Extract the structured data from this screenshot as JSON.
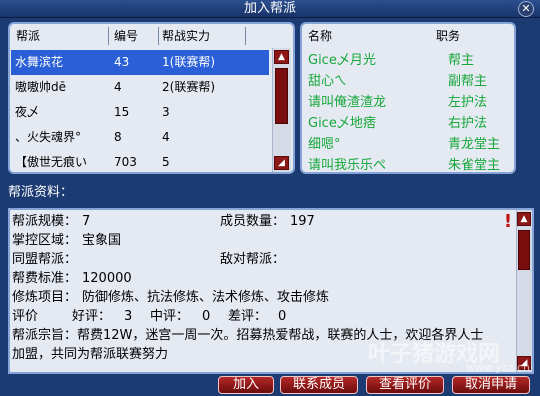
{
  "window": {
    "title": "加入帮派",
    "close_glyph": "✕"
  },
  "guild_list": {
    "headers": [
      "帮派",
      "编号",
      "帮战实力"
    ],
    "rows": [
      {
        "name": "水舞滨花",
        "id": "43",
        "power": "1(联赛帮)",
        "selected": true
      },
      {
        "name": "嗷嗷帅dē",
        "id": "4",
        "power": "2(联赛帮)",
        "selected": false
      },
      {
        "name": "夜乄",
        "id": "15",
        "power": "3",
        "selected": false
      },
      {
        "name": "、火失魂界°",
        "id": "8",
        "power": "4",
        "selected": false
      },
      {
        "name": "【傲世无痕い",
        "id": "703",
        "power": "5",
        "selected": false
      }
    ]
  },
  "member_list": {
    "headers": [
      "名称",
      "职务"
    ],
    "rows": [
      {
        "name": "Gice乄月光",
        "role": "帮主"
      },
      {
        "name": "甜心ㄟ",
        "role": "副帮主"
      },
      {
        "name": "请叫俺渣渣龙",
        "role": "左护法"
      },
      {
        "name": "Gice乄地痞",
        "role": "右护法"
      },
      {
        "name": "细嗯°",
        "role": "青龙堂主"
      },
      {
        "name": "请叫我乐乐ぺ",
        "role": "朱雀堂主"
      }
    ]
  },
  "info": {
    "section_title": "帮派资料：",
    "scale_label": "帮派规模：",
    "scale_value": "7",
    "members_label": "成员数量：",
    "members_value": "197",
    "region_label": "掌控区域：",
    "region_value": "宝象国",
    "ally_label": "同盟帮派：",
    "ally_value": "",
    "enemy_label": "敌对帮派：",
    "enemy_value": "",
    "fee_label": "帮费标准：",
    "fee_value": "120000",
    "cultivation_label": "修炼项目：",
    "cultivation_value": "防御修炼、抗法修炼、法术修炼、攻击修炼",
    "rating_label": "评价",
    "good_label": "好评：",
    "good_value": "3",
    "mid_label": "中评：",
    "mid_value": "0",
    "bad_label": "差评：",
    "bad_value": "0",
    "motto_line1": "帮派宗旨：帮费12W，迷宫一周一次。招募热爱帮战，联赛的人士，欢迎各界人士",
    "motto_line2": "加盟，共同为帮派联赛努力",
    "alert_glyph": "!"
  },
  "buttons": {
    "join": "加入",
    "contact": "联系成员",
    "view_rating": "查看评价",
    "cancel": "取消申请"
  },
  "watermark": {
    "text": "叶子猪游戏网",
    "url": "www.yzz.cn"
  },
  "colors": {
    "selected_row": "#2a5fd8",
    "member_text": "#16a83a",
    "button": "#8b1717",
    "background": "#1d3b73"
  }
}
